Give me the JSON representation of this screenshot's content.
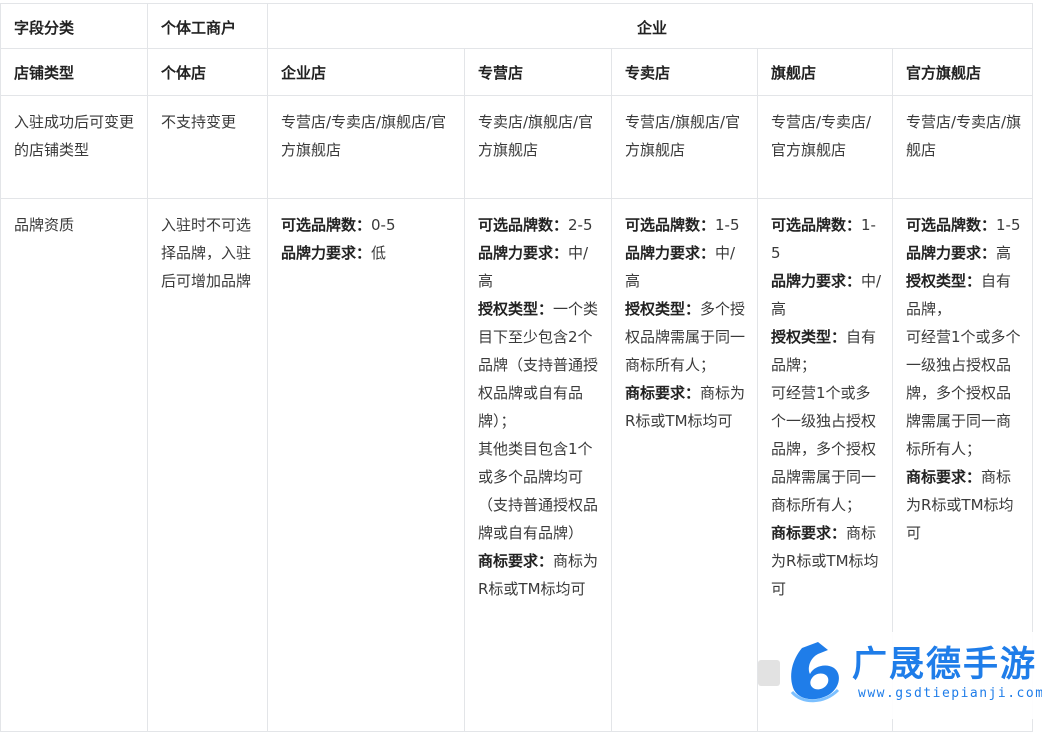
{
  "table": {
    "header": {
      "field_category": "字段分类",
      "individual": "个体工商户",
      "enterprise": "企业"
    },
    "store_type": {
      "label": "店铺类型",
      "cols": [
        "个体店",
        "企业店",
        "专营店",
        "专卖店",
        "旗舰店",
        "官方旗舰店"
      ]
    },
    "changeable": {
      "label": "入驻成功后可变更的店铺类型",
      "cols": [
        "不支持变更",
        "专营店/专卖店/旗舰店/官方旗舰店",
        "专卖店/旗舰店/官方旗舰店",
        "专营店/旗舰店/官方旗舰店",
        "专营店/专卖店/官方旗舰店",
        "专营店/专卖店/旗舰店"
      ]
    },
    "brand": {
      "label": "品牌资质",
      "individual": "入驻时不可选择品牌，入驻后可增加品牌",
      "enterprise_store": {
        "count_label": "可选品牌数：",
        "count": "0-5",
        "power_label": "品牌力要求：",
        "power": "低"
      },
      "franchise_store": {
        "count_label": "可选品牌数：",
        "count": "2-5",
        "power_label": "品牌力要求：",
        "power": "中/高",
        "auth_label": "授权类型：",
        "auth": "一个类目下至少包含2个品牌（支持普通授权品牌或自有品牌）；",
        "auth2": "其他类目包含1个或多个品牌均可（支持普通授权品牌或自有品牌）",
        "tm_label": "商标要求：",
        "tm": "商标为R标或TM标均可"
      },
      "exclusive_store": {
        "count_label": "可选品牌数：",
        "count": "1-5",
        "power_label": "品牌力要求：",
        "power": "中/高",
        "auth_label": "授权类型：",
        "auth": "多个授权品牌需属于同一商标所有人；",
        "tm_label": "商标要求：",
        "tm": "商标为R标或TM标均可"
      },
      "flagship_store": {
        "count_label": "可选品牌数：",
        "count": "1-5",
        "power_label": "品牌力要求：",
        "power": "中/高",
        "auth_label": "授权类型：",
        "auth": "自有品牌；",
        "auth2": "可经营1个或多个一级独占授权品牌，多个授权品牌需属于同一商标所有人；",
        "tm_label": "商标要求：",
        "tm": "商标为R标或TM标均可"
      },
      "official_flagship_store": {
        "count_label": "可选品牌数：",
        "count": "1-5",
        "power_label": "品牌力要求：",
        "power": "高",
        "auth_label": "授权类型：",
        "auth": "自有品牌，",
        "auth2": "可经营1个或多个一级独占授权品牌，多个授权品牌需属于同一商标所有人；",
        "tm_label": "商标要求：",
        "tm": "商标为R标或TM标均可"
      }
    }
  },
  "watermark": {
    "title": "广晟德手游",
    "url": "www.gsdtiepianji.com",
    "color": "#1f7de9"
  }
}
